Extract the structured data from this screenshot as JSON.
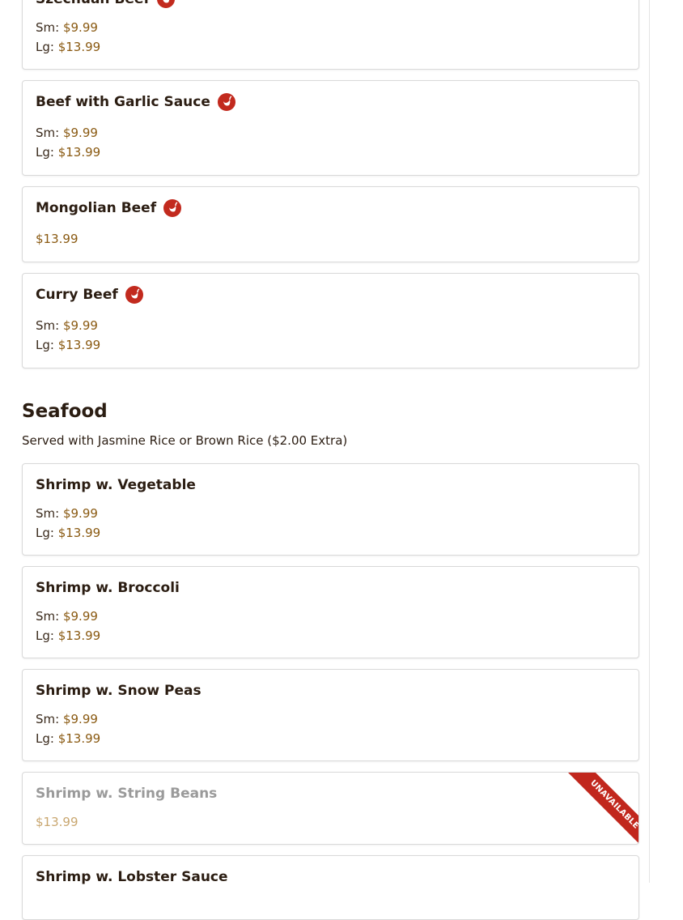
{
  "colors": {
    "spicy": "#c22a1e",
    "price": "#8a5a12",
    "ribbon": "#c1271d"
  },
  "items_top": [
    {
      "name": "Szechuan Beef",
      "spicy": true,
      "icon": "chili-pepper-icon",
      "prices": [
        {
          "label": "Sm: ",
          "amount": "$9.99"
        },
        {
          "label": "Lg: ",
          "amount": "$13.99"
        }
      ]
    },
    {
      "name": "Beef with Garlic Sauce",
      "spicy": true,
      "icon": "chili-pepper-icon",
      "prices": [
        {
          "label": "Sm: ",
          "amount": "$9.99"
        },
        {
          "label": "Lg: ",
          "amount": "$13.99"
        }
      ]
    },
    {
      "name": "Mongolian Beef",
      "spicy": true,
      "icon": "chili-pepper-icon",
      "prices": [
        {
          "label": "",
          "amount": "$13.99"
        }
      ]
    },
    {
      "name": "Curry Beef",
      "spicy": true,
      "icon": "chili-pepper-icon",
      "prices": [
        {
          "label": "Sm: ",
          "amount": "$9.99"
        },
        {
          "label": "Lg: ",
          "amount": "$13.99"
        }
      ]
    }
  ],
  "seafood": {
    "title": "Seafood",
    "description": "Served with Jasmine Rice or Brown Rice ($2.00 Extra)",
    "items": [
      {
        "name": "Shrimp w. Vegetable",
        "prices": [
          {
            "label": "Sm: ",
            "amount": "$9.99"
          },
          {
            "label": "Lg: ",
            "amount": "$13.99"
          }
        ]
      },
      {
        "name": "Shrimp w. Broccoli",
        "prices": [
          {
            "label": "Sm: ",
            "amount": "$9.99"
          },
          {
            "label": "Lg: ",
            "amount": "$13.99"
          }
        ]
      },
      {
        "name": "Shrimp w. Snow Peas",
        "prices": [
          {
            "label": "Sm: ",
            "amount": "$9.99"
          },
          {
            "label": "Lg: ",
            "amount": "$13.99"
          }
        ]
      },
      {
        "name": "Shrimp w. String Beans",
        "unavailable": true,
        "badge": "UNAVAILABLE",
        "prices": [
          {
            "label": "",
            "amount": "$13.99"
          }
        ]
      },
      {
        "name": "Shrimp w. Lobster Sauce",
        "prices": []
      }
    ]
  }
}
